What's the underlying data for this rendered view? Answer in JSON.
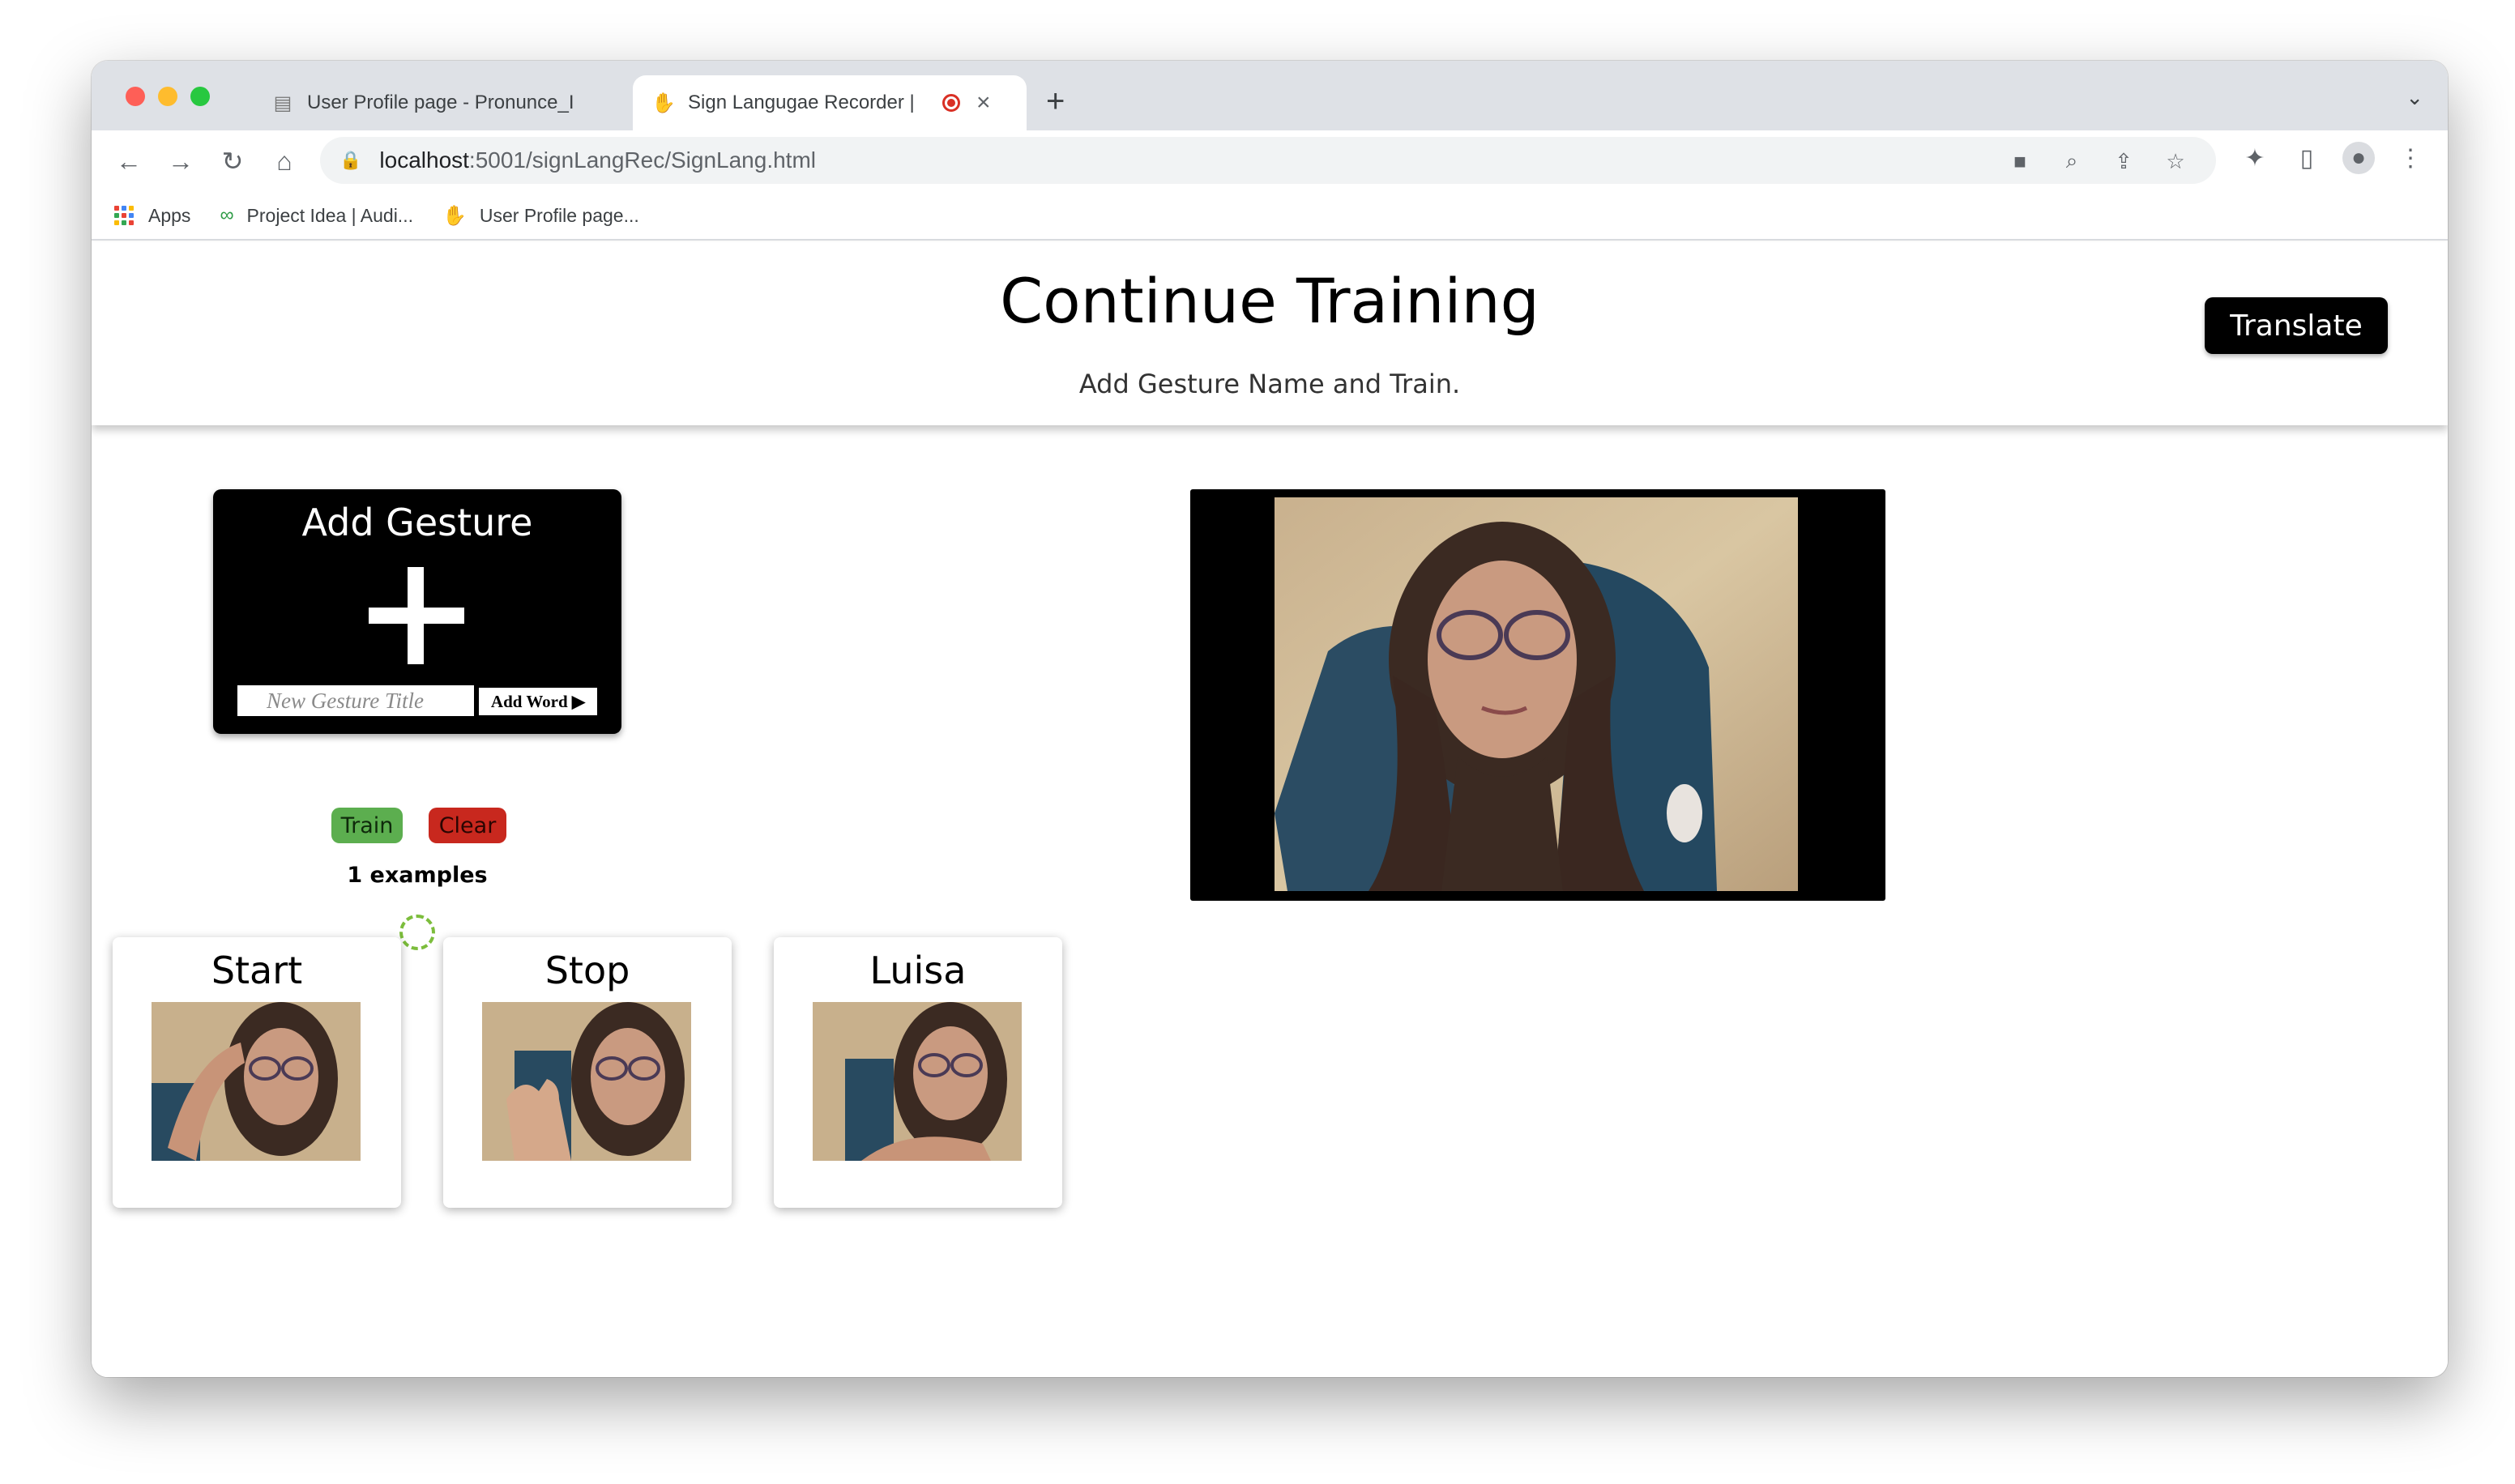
{
  "browser": {
    "tabs": [
      {
        "title": "User Profile page - Pronunce_I",
        "active": false
      },
      {
        "title": "Sign Langugae Recorder |",
        "active": true,
        "recording": true
      }
    ],
    "url_host": "localhost",
    "url_path": ":5001/signLangRec/SignLang.html",
    "bookmarks": [
      "Apps",
      "Project Idea | Audi...",
      "User Profile page..."
    ]
  },
  "page": {
    "title": "Continue Training",
    "subtitle": "Add Gesture Name and Train.",
    "translate_label": "Translate",
    "add_card": {
      "heading": "Add Gesture",
      "input_placeholder": "New Gesture Title",
      "add_word_label": "Add Word ▶"
    },
    "train_label": "Train",
    "clear_label": "Clear",
    "examples_text": "1 examples",
    "gestures": [
      {
        "name": "Start"
      },
      {
        "name": "Stop"
      },
      {
        "name": "Luisa"
      }
    ]
  },
  "colors": {
    "train": "#5cae4f",
    "clear": "#c8281e",
    "spinner": "#7cbd3c",
    "tabstrip": "#dee1e6"
  }
}
